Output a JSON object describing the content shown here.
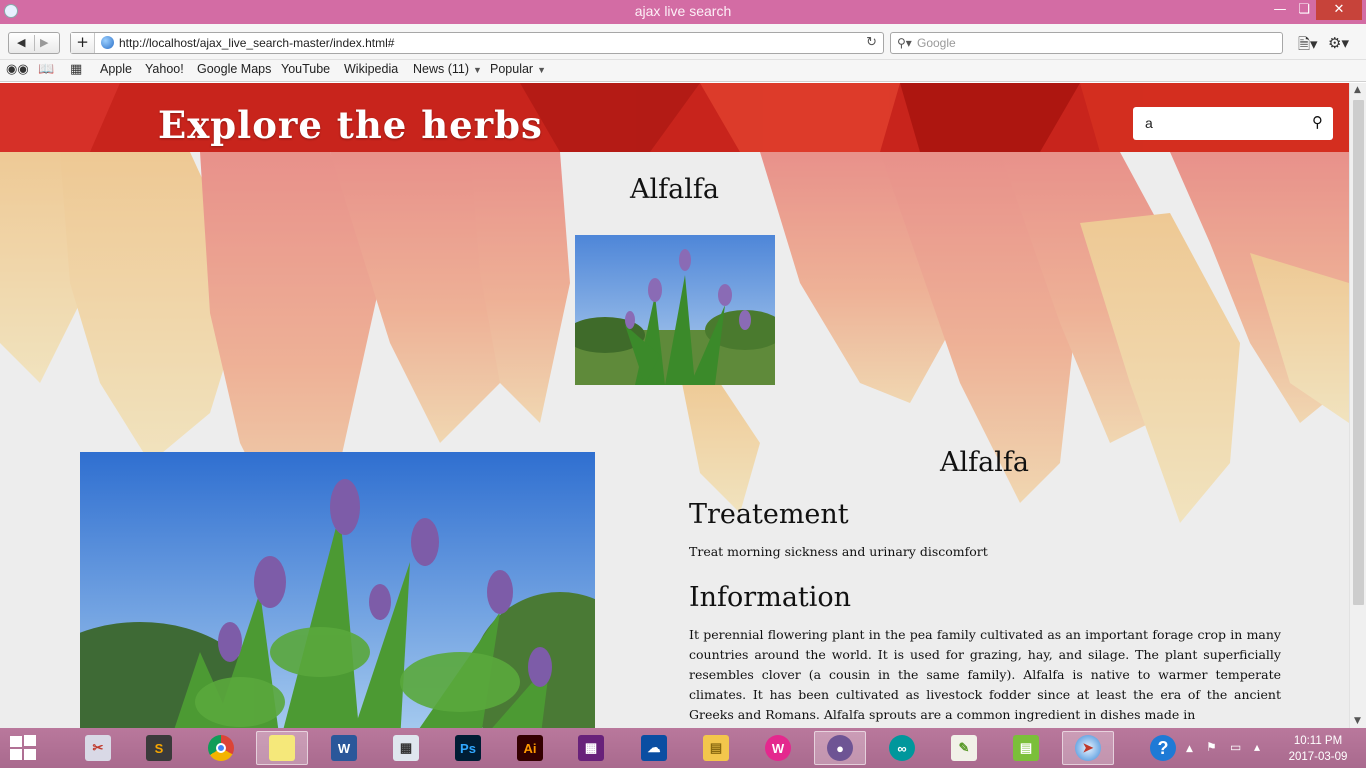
{
  "window": {
    "title": "ajax live search"
  },
  "toolbar": {
    "url": "http://localhost/ajax_live_search-master/index.html#",
    "search_placeholder": "Google"
  },
  "bookmarks": [
    {
      "label": "Apple"
    },
    {
      "label": "Yahoo!"
    },
    {
      "label": "Google Maps"
    },
    {
      "label": "YouTube"
    },
    {
      "label": "Wikipedia"
    },
    {
      "label": "News (11)",
      "dropdown": true
    },
    {
      "label": "Popular",
      "dropdown": true
    }
  ],
  "page": {
    "site_title": "Explore the herbs",
    "search_value": "a",
    "result_title": "Alfalfa",
    "detail": {
      "title": "Alfalfa",
      "treatment_heading": "Treatement",
      "treatment_text": "Treat morning sickness and urinary discomfort",
      "information_heading": "Information",
      "information_text": "It perennial flowering plant in the pea family cultivated as an important forage crop in many countries around the world. It is used for grazing, hay, and silage. The plant superficially resembles clover (a cousin in the same family). Alfalfa is native to warmer temperate climates. It has been cultivated as livestock fodder since at least the era of the ancient Greeks and Romans. Alfalfa sprouts are a common ingredient in dishes made in"
    }
  },
  "taskbar": {
    "apps": [
      "snipping-tool",
      "sublime-text",
      "chrome",
      "sticky-notes",
      "word",
      "calculator",
      "photoshop",
      "illustrator",
      "visual-studio",
      "onedrive",
      "file-explorer",
      "wamp",
      "github",
      "arduino",
      "notepad-plus",
      "hotspot",
      "safari"
    ],
    "labels": {
      "word": "W",
      "photoshop": "Ps",
      "illustrator": "Ai"
    },
    "help_glyph": "?",
    "clock_time": "10:11 PM",
    "clock_date": "2017-03-09"
  },
  "colors": {
    "titlebar": "#d36ca4",
    "taskbar": "#b9789c",
    "header_red": "#c8241c"
  }
}
